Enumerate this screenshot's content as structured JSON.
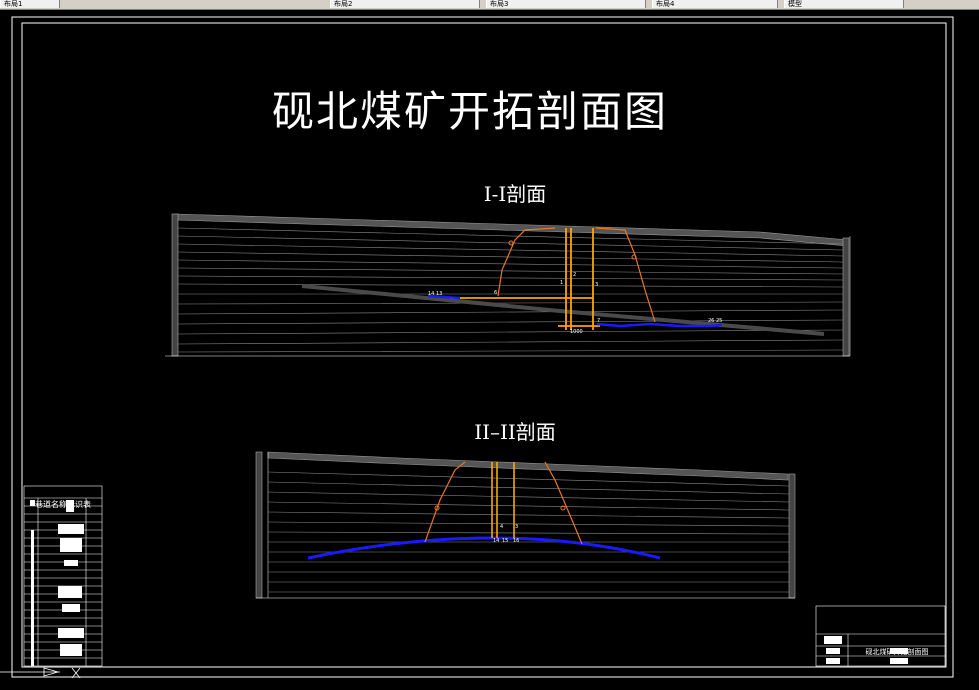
{
  "tabs": [
    {
      "label": "布局1"
    },
    {
      "label": "布局2"
    },
    {
      "label": "布局3"
    },
    {
      "label": "布局4"
    },
    {
      "label": "模型"
    }
  ],
  "drawing": {
    "title": "砚北煤矿开拓剖面图",
    "section1_title": "I-I剖面",
    "section2_title": "II–II剖面",
    "legend_title": "巷道名称标识表",
    "titleblock_title": "砚北煤矿开拓剖面图"
  },
  "colors": {
    "background": "#000000",
    "line": "#ffffff",
    "strata": "#888888",
    "seam": "#3a3a3a",
    "roadway_blue": "#1a1aff",
    "shaft_orange": "#ffa500",
    "outline_orange": "#e87722"
  }
}
